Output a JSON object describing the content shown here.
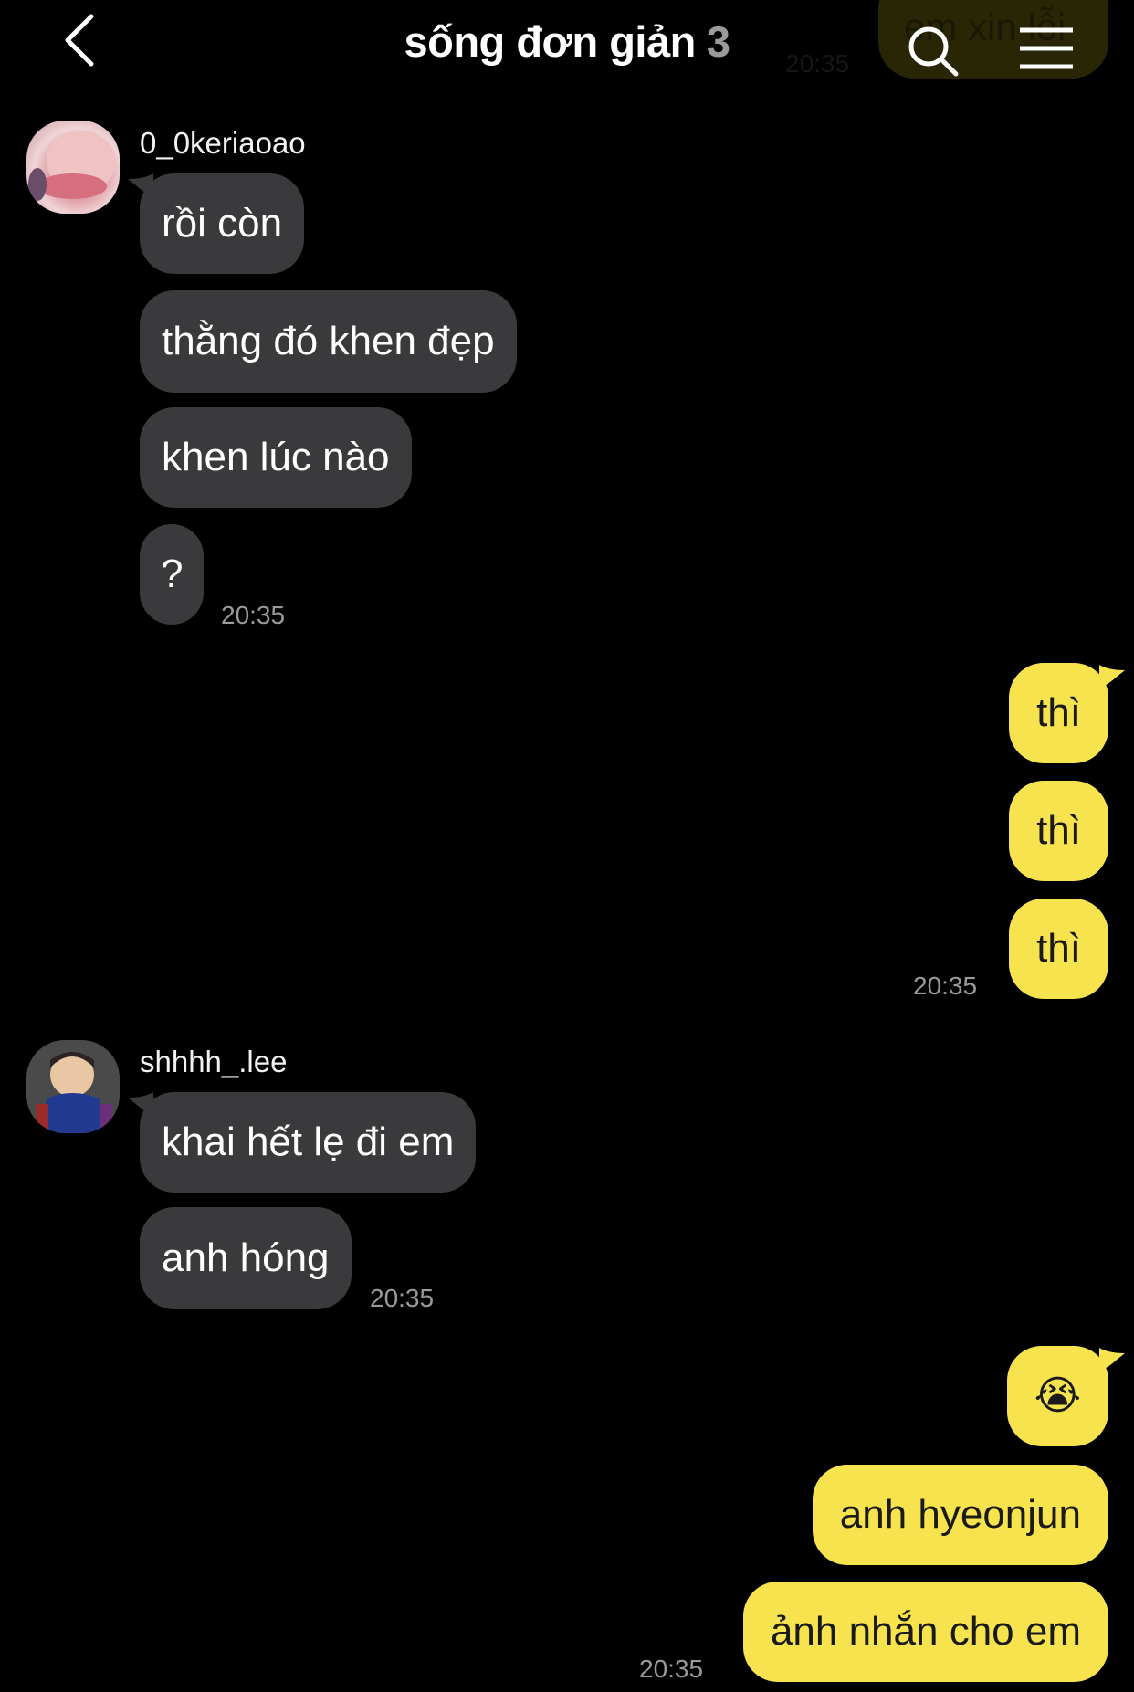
{
  "header": {
    "title": "sống đơn giản",
    "member_count": "3",
    "ghost_preview_text": "em xin lỗi",
    "ghost_preview_time": "20:35"
  },
  "messages": {
    "group1": {
      "sender": "0_0keriaoao",
      "bubbles": [
        "rồi còn",
        "thằng đó khen đẹp",
        "khen lúc nào",
        "?"
      ],
      "time": "20:35"
    },
    "group2": {
      "bubbles": [
        "thì",
        "thì",
        "thì"
      ],
      "time": "20:35"
    },
    "group3": {
      "sender": "shhhh_.lee",
      "bubbles": [
        "khai hết lẹ đi em",
        "anh hóng"
      ],
      "time": "20:35"
    },
    "group4": {
      "bubbles": [
        "😭",
        "anh hyeonjun",
        "ảnh nhắn cho em"
      ],
      "time": "20:35"
    }
  },
  "colors": {
    "background": "#000000",
    "incoming_bubble": "#3a3a3c",
    "outgoing_bubble": "#f7e34d",
    "timestamp": "#9a9a9a"
  },
  "icons": [
    "back-chevron-icon",
    "search-icon",
    "menu-icon"
  ]
}
